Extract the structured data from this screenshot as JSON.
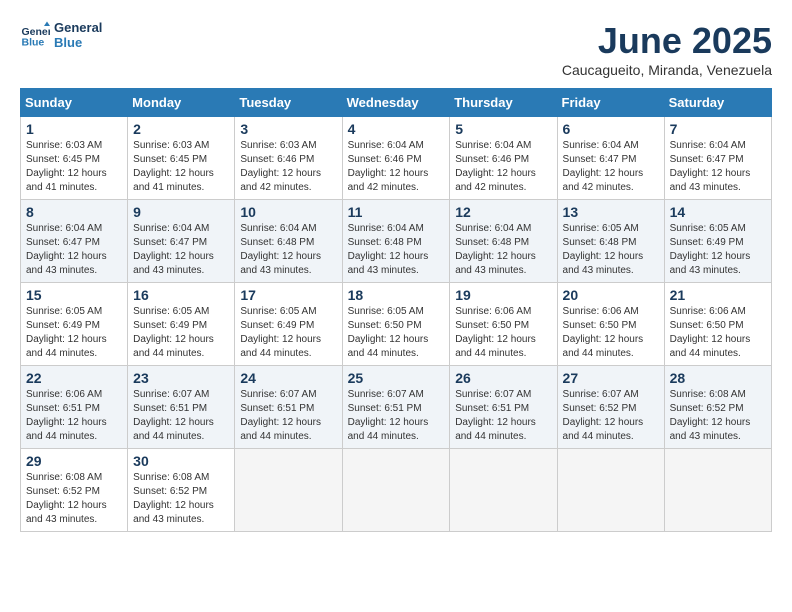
{
  "header": {
    "logo_general": "General",
    "logo_blue": "Blue",
    "month_year": "June 2025",
    "location": "Caucagueito, Miranda, Venezuela"
  },
  "calendar": {
    "days_of_week": [
      "Sunday",
      "Monday",
      "Tuesday",
      "Wednesday",
      "Thursday",
      "Friday",
      "Saturday"
    ],
    "weeks": [
      [
        {
          "day": "1",
          "sunrise": "6:03 AM",
          "sunset": "6:45 PM",
          "daylight": "12 hours and 41 minutes."
        },
        {
          "day": "2",
          "sunrise": "6:03 AM",
          "sunset": "6:45 PM",
          "daylight": "12 hours and 41 minutes."
        },
        {
          "day": "3",
          "sunrise": "6:03 AM",
          "sunset": "6:46 PM",
          "daylight": "12 hours and 42 minutes."
        },
        {
          "day": "4",
          "sunrise": "6:04 AM",
          "sunset": "6:46 PM",
          "daylight": "12 hours and 42 minutes."
        },
        {
          "day": "5",
          "sunrise": "6:04 AM",
          "sunset": "6:46 PM",
          "daylight": "12 hours and 42 minutes."
        },
        {
          "day": "6",
          "sunrise": "6:04 AM",
          "sunset": "6:47 PM",
          "daylight": "12 hours and 42 minutes."
        },
        {
          "day": "7",
          "sunrise": "6:04 AM",
          "sunset": "6:47 PM",
          "daylight": "12 hours and 43 minutes."
        }
      ],
      [
        {
          "day": "8",
          "sunrise": "6:04 AM",
          "sunset": "6:47 PM",
          "daylight": "12 hours and 43 minutes."
        },
        {
          "day": "9",
          "sunrise": "6:04 AM",
          "sunset": "6:47 PM",
          "daylight": "12 hours and 43 minutes."
        },
        {
          "day": "10",
          "sunrise": "6:04 AM",
          "sunset": "6:48 PM",
          "daylight": "12 hours and 43 minutes."
        },
        {
          "day": "11",
          "sunrise": "6:04 AM",
          "sunset": "6:48 PM",
          "daylight": "12 hours and 43 minutes."
        },
        {
          "day": "12",
          "sunrise": "6:04 AM",
          "sunset": "6:48 PM",
          "daylight": "12 hours and 43 minutes."
        },
        {
          "day": "13",
          "sunrise": "6:05 AM",
          "sunset": "6:48 PM",
          "daylight": "12 hours and 43 minutes."
        },
        {
          "day": "14",
          "sunrise": "6:05 AM",
          "sunset": "6:49 PM",
          "daylight": "12 hours and 43 minutes."
        }
      ],
      [
        {
          "day": "15",
          "sunrise": "6:05 AM",
          "sunset": "6:49 PM",
          "daylight": "12 hours and 44 minutes."
        },
        {
          "day": "16",
          "sunrise": "6:05 AM",
          "sunset": "6:49 PM",
          "daylight": "12 hours and 44 minutes."
        },
        {
          "day": "17",
          "sunrise": "6:05 AM",
          "sunset": "6:49 PM",
          "daylight": "12 hours and 44 minutes."
        },
        {
          "day": "18",
          "sunrise": "6:05 AM",
          "sunset": "6:50 PM",
          "daylight": "12 hours and 44 minutes."
        },
        {
          "day": "19",
          "sunrise": "6:06 AM",
          "sunset": "6:50 PM",
          "daylight": "12 hours and 44 minutes."
        },
        {
          "day": "20",
          "sunrise": "6:06 AM",
          "sunset": "6:50 PM",
          "daylight": "12 hours and 44 minutes."
        },
        {
          "day": "21",
          "sunrise": "6:06 AM",
          "sunset": "6:50 PM",
          "daylight": "12 hours and 44 minutes."
        }
      ],
      [
        {
          "day": "22",
          "sunrise": "6:06 AM",
          "sunset": "6:51 PM",
          "daylight": "12 hours and 44 minutes."
        },
        {
          "day": "23",
          "sunrise": "6:07 AM",
          "sunset": "6:51 PM",
          "daylight": "12 hours and 44 minutes."
        },
        {
          "day": "24",
          "sunrise": "6:07 AM",
          "sunset": "6:51 PM",
          "daylight": "12 hours and 44 minutes."
        },
        {
          "day": "25",
          "sunrise": "6:07 AM",
          "sunset": "6:51 PM",
          "daylight": "12 hours and 44 minutes."
        },
        {
          "day": "26",
          "sunrise": "6:07 AM",
          "sunset": "6:51 PM",
          "daylight": "12 hours and 44 minutes."
        },
        {
          "day": "27",
          "sunrise": "6:07 AM",
          "sunset": "6:52 PM",
          "daylight": "12 hours and 44 minutes."
        },
        {
          "day": "28",
          "sunrise": "6:08 AM",
          "sunset": "6:52 PM",
          "daylight": "12 hours and 43 minutes."
        }
      ],
      [
        {
          "day": "29",
          "sunrise": "6:08 AM",
          "sunset": "6:52 PM",
          "daylight": "12 hours and 43 minutes."
        },
        {
          "day": "30",
          "sunrise": "6:08 AM",
          "sunset": "6:52 PM",
          "daylight": "12 hours and 43 minutes."
        },
        null,
        null,
        null,
        null,
        null
      ]
    ],
    "sunrise_label": "Sunrise:",
    "sunset_label": "Sunset:",
    "daylight_label": "Daylight:"
  }
}
